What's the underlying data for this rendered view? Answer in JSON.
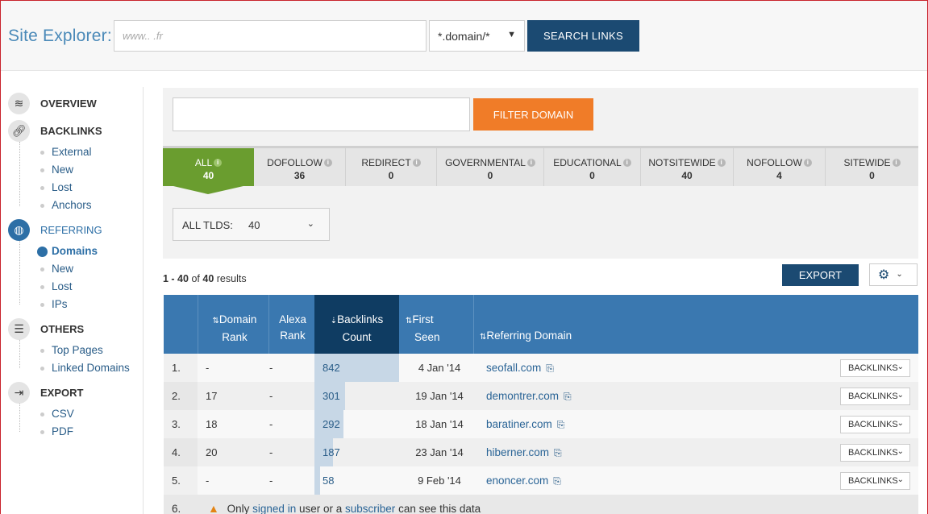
{
  "header": {
    "brand": "Site Explorer:",
    "url_placeholder": "www.. .fr",
    "scope": "*.domain/*",
    "search_label": "SEARCH LINKS"
  },
  "sidebar": {
    "sections": [
      {
        "label": "OVERVIEW",
        "icon": "layers-icon"
      },
      {
        "label": "BACKLINKS",
        "icon": "link-icon",
        "items": [
          "External",
          "New",
          "Lost",
          "Anchors"
        ]
      },
      {
        "label": "REFERRING",
        "icon": "globe-icon",
        "items": [
          "Domains",
          "New",
          "Lost",
          "IPs"
        ],
        "current": "Domains"
      },
      {
        "label": "OTHERS",
        "icon": "list-icon",
        "items": [
          "Top Pages",
          "Linked Domains"
        ]
      },
      {
        "label": "EXPORT",
        "icon": "export-icon",
        "items": [
          "CSV",
          "PDF"
        ]
      }
    ]
  },
  "filter": {
    "button_label": "FILTER DOMAIN"
  },
  "tabs": [
    {
      "label": "ALL",
      "value": "40",
      "active": true
    },
    {
      "label": "DOFOLLOW",
      "value": "36"
    },
    {
      "label": "REDIRECT",
      "value": "0"
    },
    {
      "label": "GOVERNMENTAL",
      "value": "0"
    },
    {
      "label": "EDUCATIONAL",
      "value": "0"
    },
    {
      "label": "NOTSITEWIDE",
      "value": "40"
    },
    {
      "label": "NOFOLLOW",
      "value": "4"
    },
    {
      "label": "SITEWIDE",
      "value": "0"
    }
  ],
  "tld": {
    "label": "ALL TLDS:",
    "count": "40"
  },
  "results": {
    "range": "1 - 40",
    "of": "of",
    "total": "40",
    "suffix": "results"
  },
  "toolbar": {
    "export_label": "EXPORT"
  },
  "table": {
    "headers": {
      "domain_rank": [
        "Domain",
        "Rank"
      ],
      "alexa_rank": [
        "Alexa",
        "Rank"
      ],
      "backlinks_count": [
        "Backlinks",
        "Count"
      ],
      "first_seen": [
        "First",
        "Seen"
      ],
      "referring_domain": "Referring Domain"
    },
    "rows": [
      {
        "num": "1.",
        "domain_rank": "-",
        "alexa_rank": "-",
        "backlinks": "842",
        "first_seen": "4 Jan '14",
        "domain": "seofall.com",
        "action": "BACKLINKS"
      },
      {
        "num": "2.",
        "domain_rank": "17",
        "alexa_rank": "-",
        "backlinks": "301",
        "first_seen": "19 Jan '14",
        "domain": "demontrer.com",
        "action": "BACKLINKS"
      },
      {
        "num": "3.",
        "domain_rank": "18",
        "alexa_rank": "-",
        "backlinks": "292",
        "first_seen": "18 Jan '14",
        "domain": "baratiner.com",
        "action": "BACKLINKS"
      },
      {
        "num": "4.",
        "domain_rank": "20",
        "alexa_rank": "-",
        "backlinks": "187",
        "first_seen": "23 Jan '14",
        "domain": "hiberner.com",
        "action": "BACKLINKS"
      },
      {
        "num": "5.",
        "domain_rank": "-",
        "alexa_rank": "-",
        "backlinks": "58",
        "first_seen": "9 Feb '14",
        "domain": "enoncer.com",
        "action": "BACKLINKS"
      }
    ],
    "row6": {
      "num": "6.",
      "pre": "Only",
      "signed_in": "signed in",
      "mid": "user or a",
      "subscriber": "subscriber",
      "post": "can see this data"
    }
  },
  "colors": {
    "accent": "#1b4a72",
    "filter": "#f07c28",
    "active_tab": "#6a9d2f",
    "table_header": "#3a78b0"
  }
}
